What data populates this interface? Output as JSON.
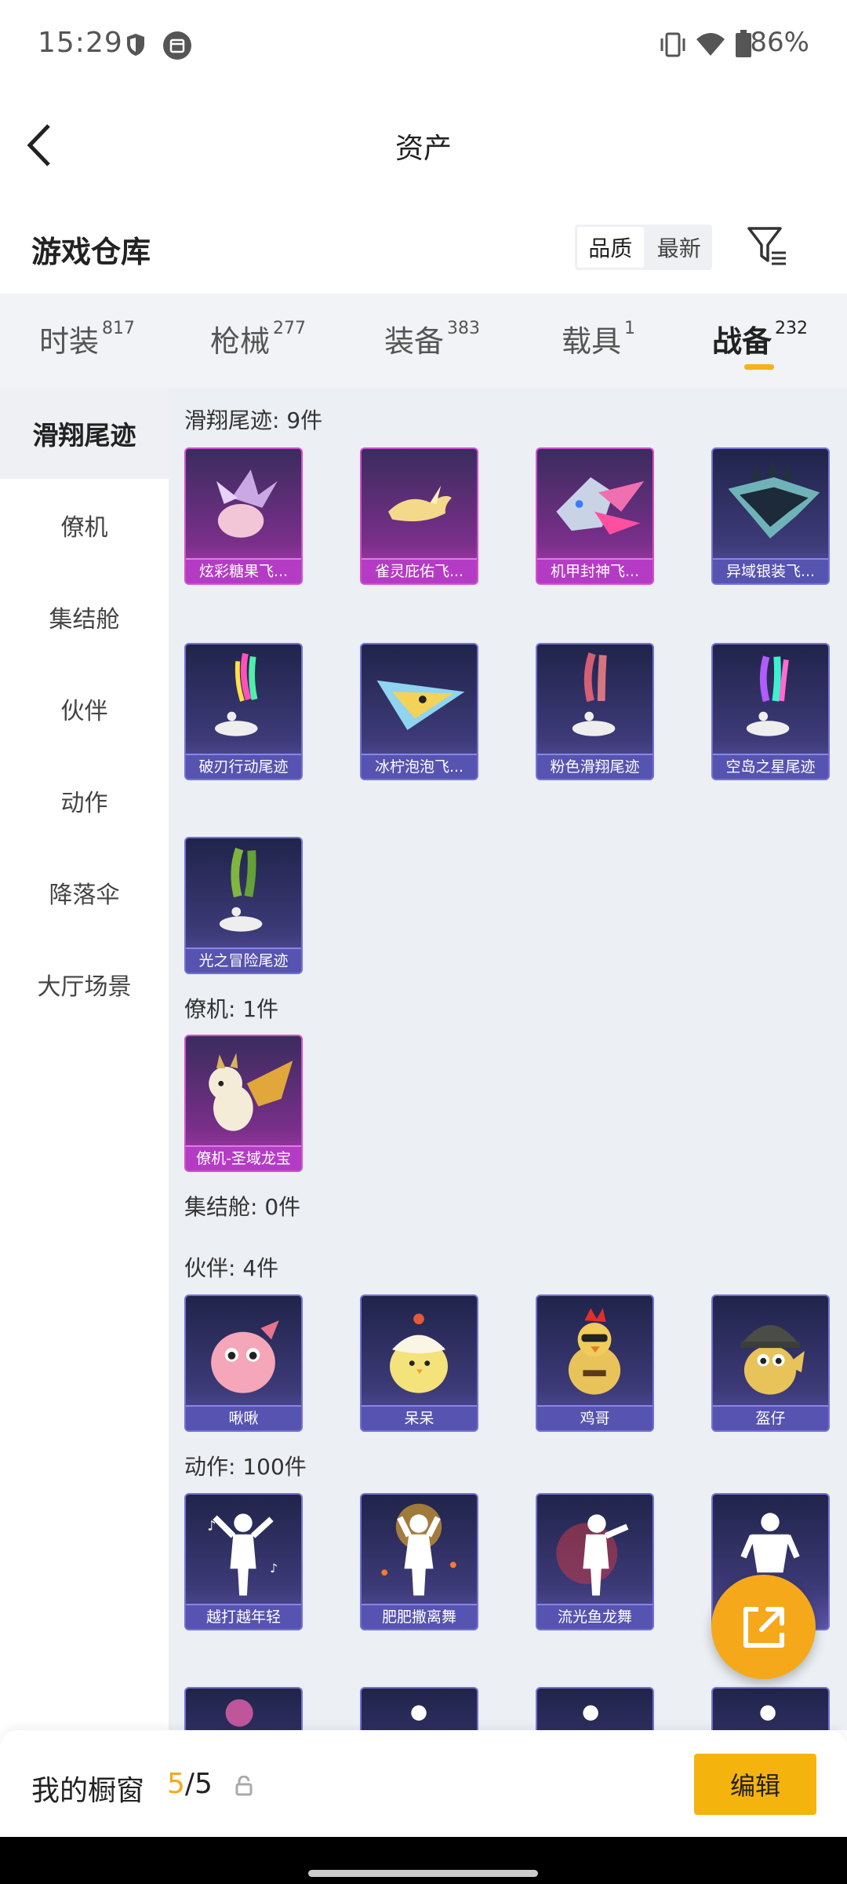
{
  "status_bar": {
    "time": "15:29",
    "battery": "86%",
    "icons": [
      "shield-icon",
      "calendar-icon",
      "vibrate-icon",
      "wifi-icon",
      "battery-icon"
    ]
  },
  "header": {
    "title": "资产",
    "back_icon": "chevron-left-icon"
  },
  "warehouse": {
    "title": "游戏仓库",
    "sort_options": [
      "品质",
      "最新"
    ],
    "sort_selected": "品质",
    "filter_icon": "filter-icon"
  },
  "tabs": [
    {
      "label": "时装",
      "count": "817"
    },
    {
      "label": "枪械",
      "count": "277"
    },
    {
      "label": "装备",
      "count": "383"
    },
    {
      "label": "载具",
      "count": "1"
    },
    {
      "label": "战备",
      "count": "232",
      "active": true
    }
  ],
  "sidebar": {
    "items": [
      "滑翔尾迹",
      "僚机",
      "集结舱",
      "伙伴",
      "动作",
      "降落伞",
      "大厅场景"
    ],
    "active": "滑翔尾迹"
  },
  "sections": {
    "glide": {
      "title": "滑翔尾迹: 9件",
      "items": [
        "炫彩糖果飞...",
        "雀灵庇佑飞...",
        "机甲封神飞...",
        "异域银装飞...",
        "破刃行动尾迹",
        "冰柠泡泡飞...",
        "粉色滑翔尾迹",
        "空岛之星尾迹",
        "光之冒险尾迹"
      ]
    },
    "wingman": {
      "title": "僚机: 1件",
      "items": [
        "僚机-圣域龙宝"
      ]
    },
    "pod": {
      "title": "集结舱: 0件"
    },
    "partner": {
      "title": "伙伴: 4件",
      "items": [
        "啾啾",
        "呆呆",
        "鸡哥",
        "盔仔"
      ]
    },
    "emote": {
      "title": "动作: 100件",
      "items": [
        "越打越年轻",
        "肥肥撒离舞",
        "流光鱼龙舞"
      ]
    }
  },
  "bottom_bar": {
    "label": "我的橱窗",
    "current": "5",
    "total": "/5",
    "edit_label": "编辑"
  },
  "colors": {
    "accent": "#f5b30e",
    "pink_rarity": "#b43cc4",
    "purple_rarity": "#5753b0"
  }
}
